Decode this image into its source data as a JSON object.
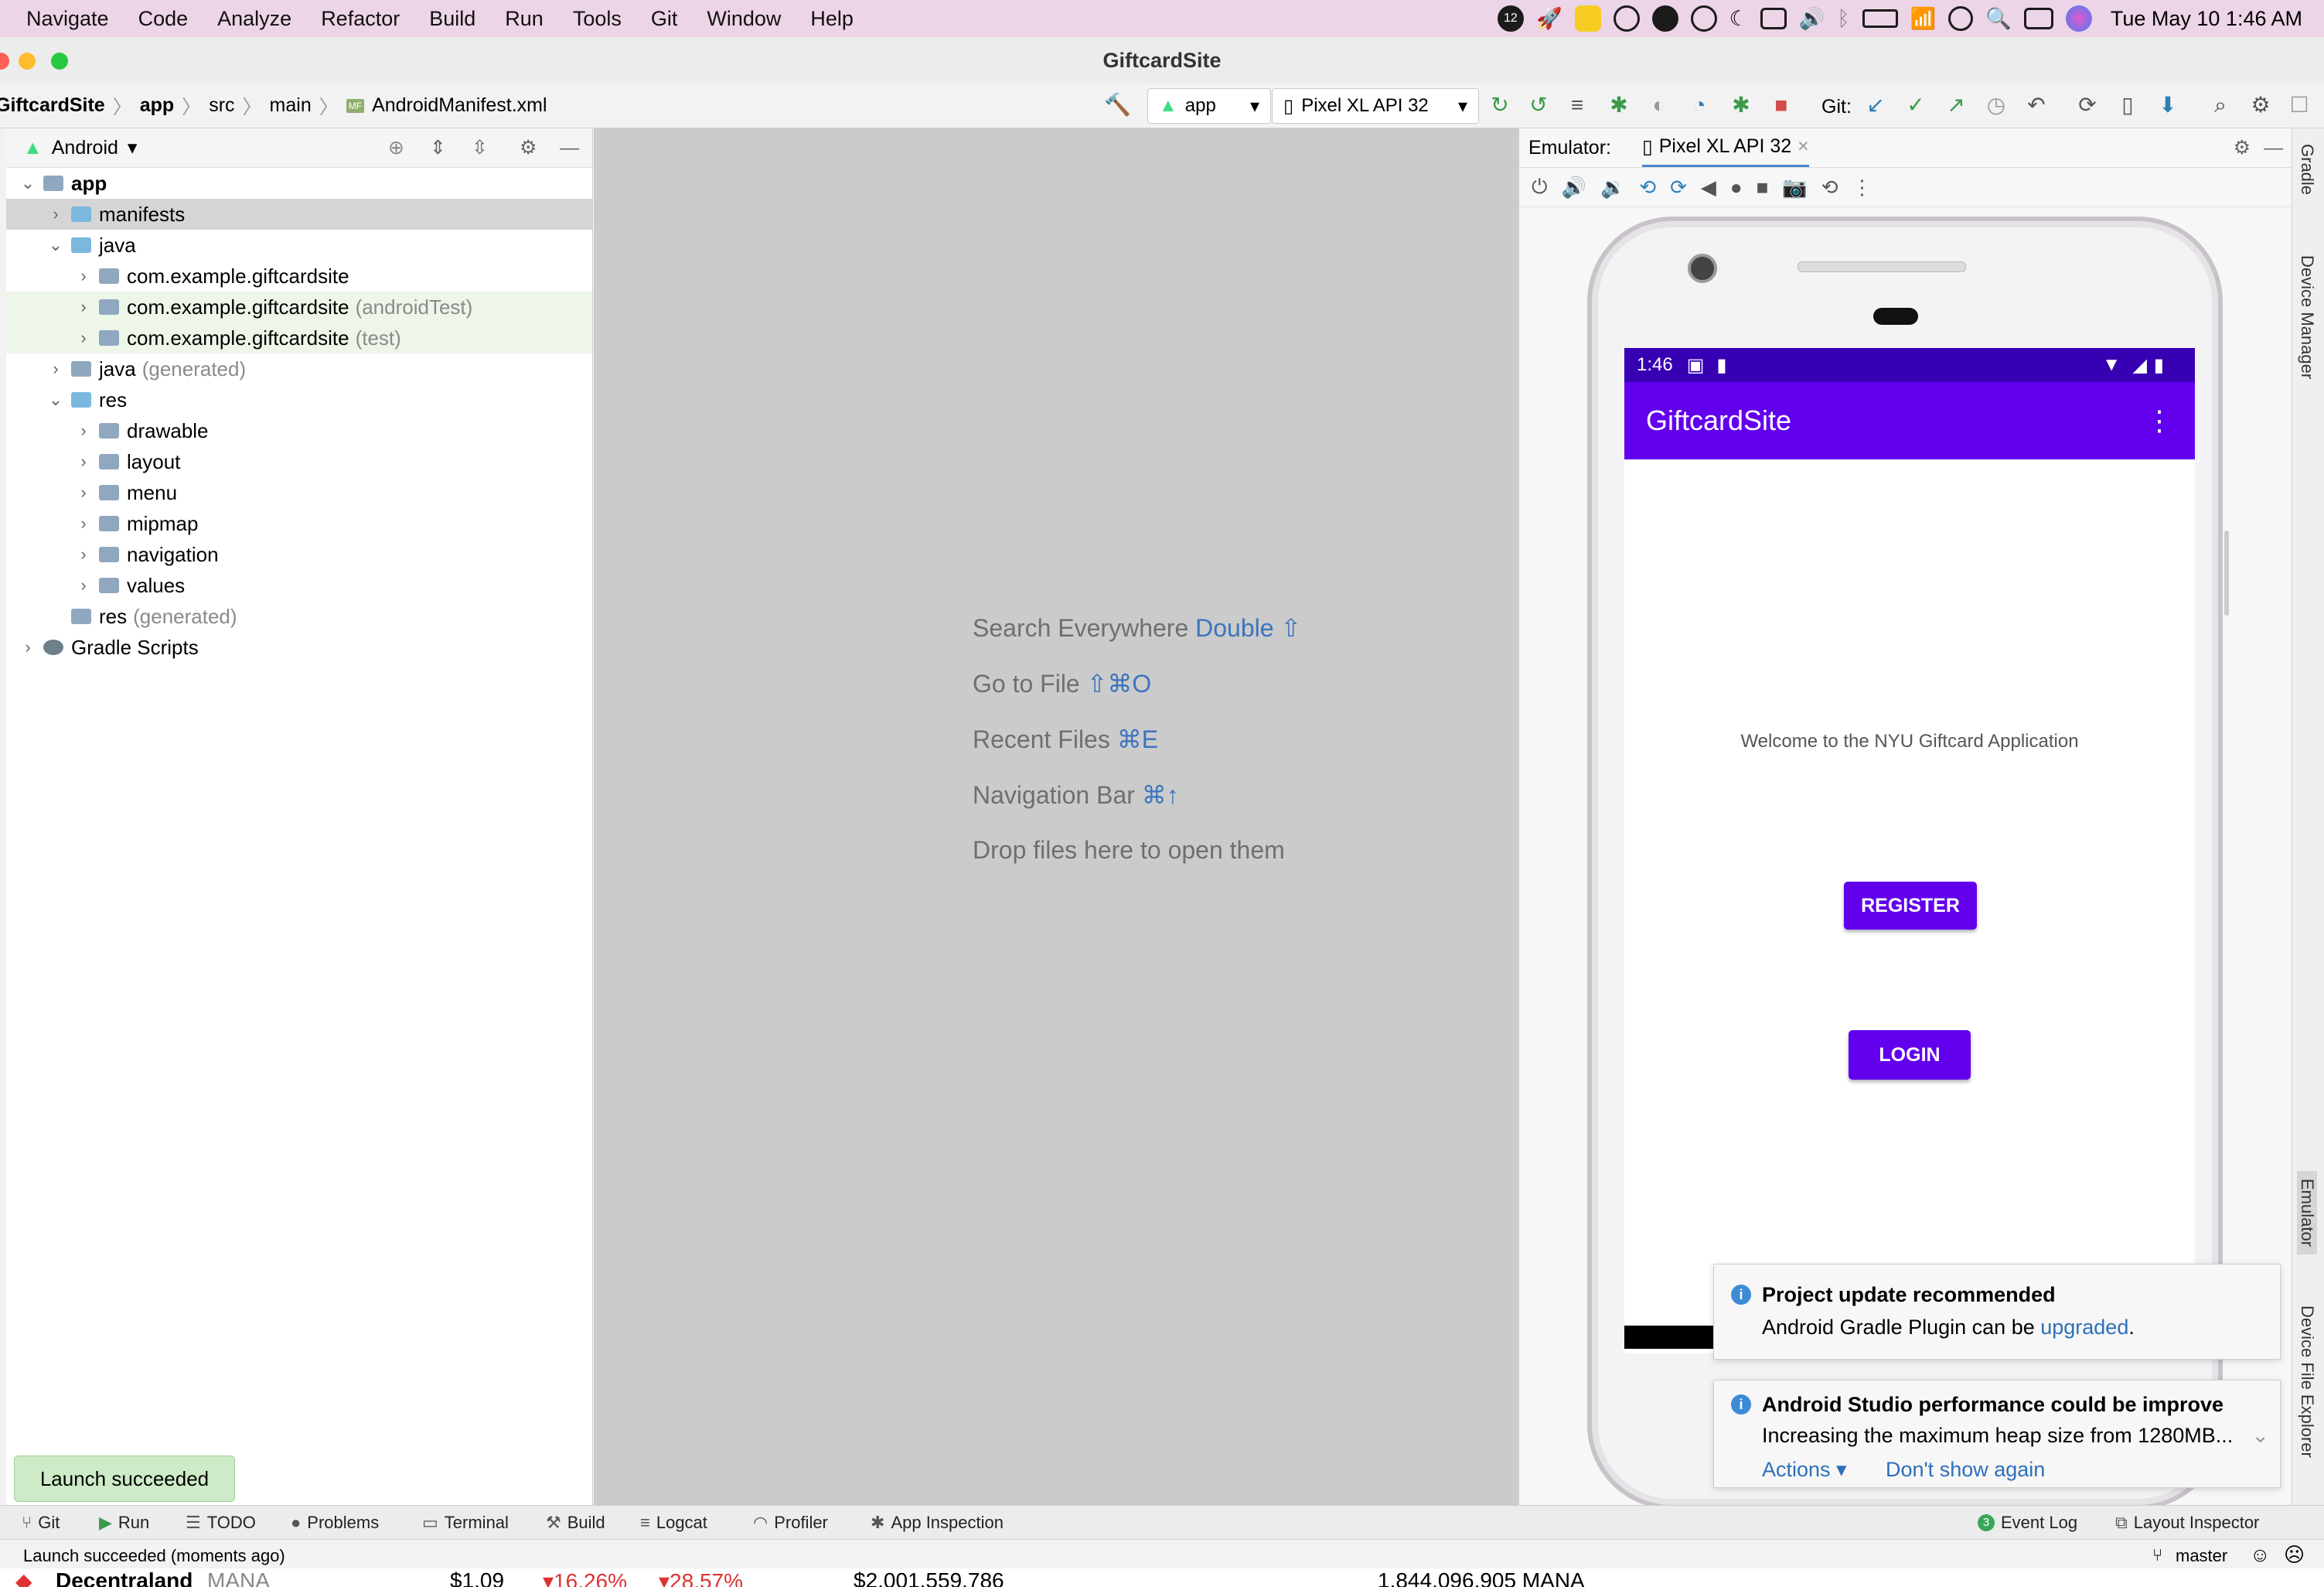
{
  "menubar": {
    "items": [
      "Navigate",
      "Code",
      "Analyze",
      "Refactor",
      "Build",
      "Run",
      "Tools",
      "Git",
      "Window",
      "Help"
    ],
    "notif_badge": "12",
    "clock": "Tue May 10  1:46 AM"
  },
  "window": {
    "title": "GiftcardSite"
  },
  "breadcrumb": {
    "items": [
      "GiftcardSite",
      "app",
      "src",
      "main",
      "AndroidManifest.xml"
    ],
    "file_badge": "MF"
  },
  "toolbar": {
    "run_config": "app",
    "device": "Pixel XL API 32",
    "git_label": "Git:"
  },
  "project": {
    "view_label": "Android",
    "tree": [
      {
        "label": "app",
        "hint": "",
        "level": 0,
        "open": true,
        "bold": true
      },
      {
        "label": "manifests",
        "hint": "",
        "level": 1,
        "open": false,
        "selected": true
      },
      {
        "label": "java",
        "hint": "",
        "level": 1,
        "open": true
      },
      {
        "label": "com.example.giftcardsite",
        "hint": "",
        "level": 2,
        "open": false
      },
      {
        "label": "com.example.giftcardsite",
        "hint": "(androidTest)",
        "level": 2,
        "open": false,
        "tint": true
      },
      {
        "label": "com.example.giftcardsite",
        "hint": "(test)",
        "level": 2,
        "open": false,
        "tint": true
      },
      {
        "label": "java",
        "hint": "(generated)",
        "level": 1,
        "open": false
      },
      {
        "label": "res",
        "hint": "",
        "level": 1,
        "open": true
      },
      {
        "label": "drawable",
        "hint": "",
        "level": 2,
        "open": false
      },
      {
        "label": "layout",
        "hint": "",
        "level": 2,
        "open": false
      },
      {
        "label": "menu",
        "hint": "",
        "level": 2,
        "open": false
      },
      {
        "label": "mipmap",
        "hint": "",
        "level": 2,
        "open": false
      },
      {
        "label": "navigation",
        "hint": "",
        "level": 2,
        "open": false
      },
      {
        "label": "values",
        "hint": "",
        "level": 2,
        "open": false
      },
      {
        "label": "res",
        "hint": "(generated)",
        "level": 1,
        "leaf": true
      },
      {
        "label": "Gradle Scripts",
        "hint": "",
        "level": 0,
        "open": false
      }
    ]
  },
  "editor_hints": [
    {
      "text": "Search Everywhere",
      "key": "Double ⇧"
    },
    {
      "text": "Go to File",
      "key": "⇧⌘O"
    },
    {
      "text": "Recent Files",
      "key": "⌘E"
    },
    {
      "text": "Navigation Bar",
      "key": "⌘↑"
    },
    {
      "text": "Drop files here to open them",
      "key": ""
    }
  ],
  "emulator": {
    "label": "Emulator:",
    "tab": "Pixel XL API 32",
    "phone": {
      "time": "1:46",
      "app_title": "GiftcardSite",
      "welcome": "Welcome to the NYU Giftcard Application",
      "register": "REGISTER",
      "login": "LOGIN"
    }
  },
  "right_tabs": [
    "Gradle",
    "Device Manager",
    "Emulator",
    "Device File Explorer"
  ],
  "notifications": [
    {
      "title": "Project update recommended",
      "body": "Android Gradle Plugin can be ",
      "link": "upgraded",
      "tail": "."
    },
    {
      "title": "Android Studio performance could be improve",
      "body": "Increasing the maximum heap size from 1280MB...",
      "actions": "Actions ▾",
      "dismiss": "Don't show again"
    }
  ],
  "toast": "Launch succeeded",
  "tool_tabs": [
    "Git",
    "Run",
    "TODO",
    "Problems",
    "Terminal",
    "Build",
    "Logcat",
    "Profiler",
    "App Inspection"
  ],
  "tool_tabs_right": [
    {
      "label": "Event Log",
      "badge": "3"
    },
    {
      "label": "Layout Inspector"
    }
  ],
  "status": {
    "message": "Launch succeeded (moments ago)",
    "branch": "master"
  },
  "ticker": {
    "name": "Decentraland",
    "symbol": "MANA",
    "price": "$1.09",
    "chg1": "▾16.26%",
    "chg2": "▾28.57%",
    "cap": "$2,001,559,786",
    "supply": "1,844,096,905 MANA"
  },
  "colors": {
    "accent_purple": "#6200ee",
    "status_purple": "#3700b3",
    "link_blue": "#3d74bf"
  }
}
